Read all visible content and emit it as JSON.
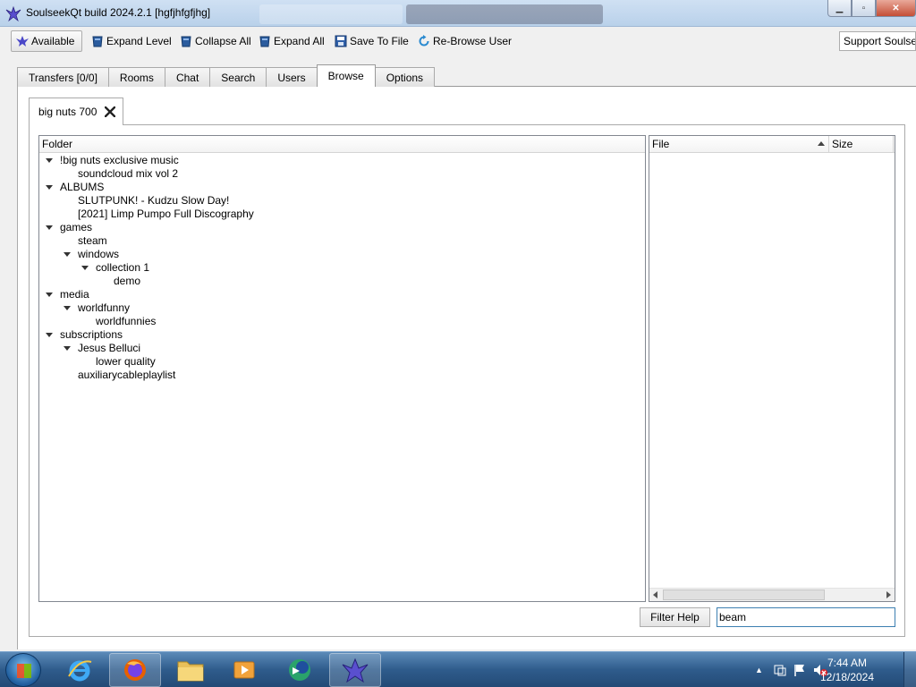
{
  "window": {
    "title": "SoulseekQt build 2024.2.1 [hgfjhfgfjhg]"
  },
  "toolbar": {
    "available_label": "Available",
    "expand_level_label": "Expand Level",
    "collapse_all_label": "Collapse All",
    "expand_all_label": "Expand All",
    "save_to_file_label": "Save To File",
    "rebrowse_label": "Re-Browse User",
    "support_label": "Support Soulseek"
  },
  "tabs": [
    {
      "label": "Transfers [0/0]"
    },
    {
      "label": "Rooms"
    },
    {
      "label": "Chat"
    },
    {
      "label": "Search"
    },
    {
      "label": "Users"
    },
    {
      "label": "Browse"
    },
    {
      "label": "Options"
    }
  ],
  "browse": {
    "user_tab_label": "big nuts 700",
    "folder_header": "Folder",
    "folders": [
      {
        "label": "!big nuts exclusive music",
        "depth": 0,
        "expanded": true
      },
      {
        "label": "soundcloud mix vol 2",
        "depth": 1,
        "expanded": false
      },
      {
        "label": "ALBUMS",
        "depth": 0,
        "expanded": true
      },
      {
        "label": "SLUTPUNK! - Kudzu Slow Day!",
        "depth": 1,
        "expanded": false
      },
      {
        "label": "[2021] Limp Pumpo Full Discography",
        "depth": 1,
        "expanded": false
      },
      {
        "label": "games",
        "depth": 0,
        "expanded": true
      },
      {
        "label": "steam",
        "depth": 1,
        "expanded": false
      },
      {
        "label": "windows",
        "depth": 1,
        "expanded": true
      },
      {
        "label": "collection 1",
        "depth": 2,
        "expanded": true
      },
      {
        "label": "demo",
        "depth": 3,
        "expanded": false
      },
      {
        "label": "media",
        "depth": 0,
        "expanded": true
      },
      {
        "label": "worldfunny",
        "depth": 1,
        "expanded": true
      },
      {
        "label": "worldfunnies",
        "depth": 2,
        "expanded": false
      },
      {
        "label": "subscriptions",
        "depth": 0,
        "expanded": true
      },
      {
        "label": "Jesus Belluci",
        "depth": 1,
        "expanded": true
      },
      {
        "label": "lower quality",
        "depth": 2,
        "expanded": false
      },
      {
        "label": "auxiliarycableplaylist",
        "depth": 1,
        "expanded": false
      }
    ],
    "file_header": "File",
    "size_header": "Size",
    "filter_help_label": "Filter Help",
    "filter_value": "beam"
  },
  "taskbar": {
    "time": "7:44 AM",
    "date": "12/18/2024"
  },
  "colors": {
    "title_bar": "#b9d1ea",
    "taskbar": "#2f5c8c",
    "input_focus_border": "#3c7fb1"
  }
}
